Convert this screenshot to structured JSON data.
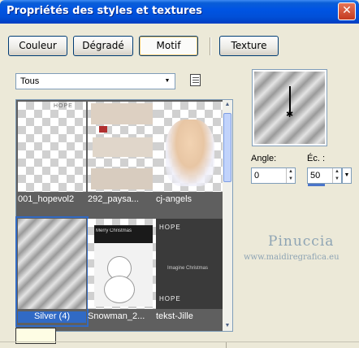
{
  "window": {
    "title": "Propriétés des styles et textures",
    "close_glyph": "✕"
  },
  "tabs": [
    {
      "label": "Couleur"
    },
    {
      "label": "Dégradé"
    },
    {
      "label": "Motif",
      "active": true
    },
    {
      "label": "Texture"
    }
  ],
  "category": {
    "selected": "Tous",
    "arrow": "▼"
  },
  "thumbnails": [
    {
      "label": "001_hopevol2"
    },
    {
      "label": "292_paysa..."
    },
    {
      "label": "cj-angels"
    },
    {
      "label": "Silver (4)",
      "selected": true
    },
    {
      "label": "Snowman_2..."
    },
    {
      "label": "tekst-Jille"
    }
  ],
  "thumb_text": {
    "hope": "HOPE",
    "imagine": "Imagine Christmas",
    "tree": "Merry Christmas"
  },
  "scroll": {
    "up": "▲",
    "down": "▼"
  },
  "preview": {
    "marker": "✱"
  },
  "angle": {
    "label": "Angle:",
    "value": "0"
  },
  "scale": {
    "label": "Éc. :",
    "value": "50",
    "fill_percent": 50
  },
  "spin_glyphs": {
    "up": "▲",
    "down": "▼"
  },
  "watermark": {
    "name": "Pinuccia",
    "url": "www.maidiregrafica.eu"
  },
  "colors": {
    "accent": "#316ac5",
    "titlebar": "#0054e3",
    "swatch": "#fefde4"
  }
}
